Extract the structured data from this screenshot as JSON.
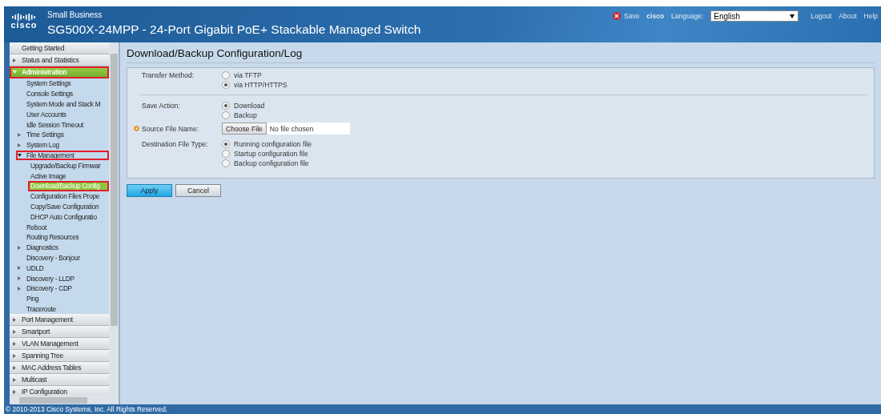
{
  "header": {
    "logo_text": "cisco",
    "product_line": "Small Business",
    "title": "SG500X-24MPP - 24-Port Gigabit PoE+ Stackable Managed Switch",
    "save": "Save",
    "user": "cisco",
    "language_label": "Language:",
    "language": "English",
    "links": [
      "Logout",
      "About",
      "Help"
    ]
  },
  "sidebar": {
    "items": [
      {
        "label": "Getting Started",
        "selected": false,
        "outlined": false
      },
      {
        "label": "Status and Statistics",
        "expanded": false,
        "selected": false,
        "outlined": false
      },
      {
        "label": "Administration",
        "expanded": true,
        "selected": true,
        "outlined": true,
        "children": [
          {
            "label": "System Settings",
            "selected": false,
            "outlined": false
          },
          {
            "label": "Console Settings",
            "selected": false,
            "outlined": false
          },
          {
            "label": "System Mode and Stack M",
            "selected": false,
            "outlined": false
          },
          {
            "label": "User Accounts",
            "selected": false,
            "outlined": false
          },
          {
            "label": "Idle Session Timeout",
            "selected": false,
            "outlined": false
          },
          {
            "label": "Time Settings",
            "expanded": false,
            "selected": false,
            "outlined": false
          },
          {
            "label": "System Log",
            "expanded": false,
            "selected": false,
            "outlined": false
          },
          {
            "label": "File Management",
            "expanded": true,
            "selected": false,
            "outlined": true,
            "children": [
              {
                "label": "Upgrade/Backup Firmwar",
                "selected": false,
                "outlined": false
              },
              {
                "label": "Active Image",
                "selected": false,
                "outlined": false
              },
              {
                "label": "Download/Backup Config",
                "selected": true,
                "outlined": true
              },
              {
                "label": "Configuration Files Prope",
                "selected": false,
                "outlined": false
              },
              {
                "label": "Copy/Save Configuration",
                "selected": false,
                "outlined": false
              },
              {
                "label": "DHCP Auto Configuratio",
                "selected": false,
                "outlined": false
              }
            ]
          },
          {
            "label": "Reboot",
            "selected": false,
            "outlined": false
          },
          {
            "label": "Routing Resources",
            "selected": false,
            "outlined": false
          },
          {
            "label": "Diagnostics",
            "expanded": false,
            "selected": false,
            "outlined": false
          },
          {
            "label": "Discovery - Bonjour",
            "selected": false,
            "outlined": false
          },
          {
            "label": "UDLD",
            "expanded": false,
            "selected": false,
            "outlined": false
          },
          {
            "label": "Discovery - LLDP",
            "expanded": false,
            "selected": false,
            "outlined": false
          },
          {
            "label": "Discovery - CDP",
            "expanded": false,
            "selected": false,
            "outlined": false
          },
          {
            "label": "Ping",
            "selected": false,
            "outlined": false
          },
          {
            "label": "Traceroute",
            "selected": false,
            "outlined": false
          }
        ]
      },
      {
        "label": "Port Management",
        "expanded": false,
        "selected": false,
        "outlined": false
      },
      {
        "label": "Smartport",
        "expanded": false,
        "selected": false,
        "outlined": false
      },
      {
        "label": "VLAN Management",
        "expanded": false,
        "selected": false,
        "outlined": false
      },
      {
        "label": "Spanning Tree",
        "expanded": false,
        "selected": false,
        "outlined": false
      },
      {
        "label": "MAC Address Tables",
        "expanded": false,
        "selected": false,
        "outlined": false
      },
      {
        "label": "Multicast",
        "expanded": false,
        "selected": false,
        "outlined": false
      },
      {
        "label": "IP Configuration",
        "expanded": false,
        "selected": false,
        "outlined": false
      }
    ]
  },
  "page": {
    "title": "Download/Backup Configuration/Log",
    "sections": [
      [
        {
          "kind": "radio",
          "label": "Transfer Method:",
          "options": [
            {
              "label": "via TFTP",
              "selected": false
            },
            {
              "label": "via HTTP/HTTPS",
              "selected": true
            }
          ]
        }
      ],
      [
        {
          "kind": "radio",
          "label": "Save Action:",
          "options": [
            {
              "label": "Download",
              "selected": true
            },
            {
              "label": "Backup",
              "selected": false
            }
          ]
        },
        {
          "kind": "file",
          "label": "Source File Name:",
          "required": true,
          "button": "Choose File",
          "value": "No file chosen"
        },
        {
          "kind": "radio",
          "label": "Destination File Type:",
          "options": [
            {
              "label": "Running configuration file",
              "selected": true
            },
            {
              "label": "Startup configuration file",
              "selected": false
            },
            {
              "label": "Backup configuration file",
              "selected": false
            }
          ]
        }
      ]
    ],
    "buttons": [
      {
        "label": "Apply",
        "primary": true
      },
      {
        "label": "Cancel",
        "primary": false
      }
    ]
  },
  "footer": "© 2010-2013 Cisco Systems, Inc. All Rights Reserved."
}
